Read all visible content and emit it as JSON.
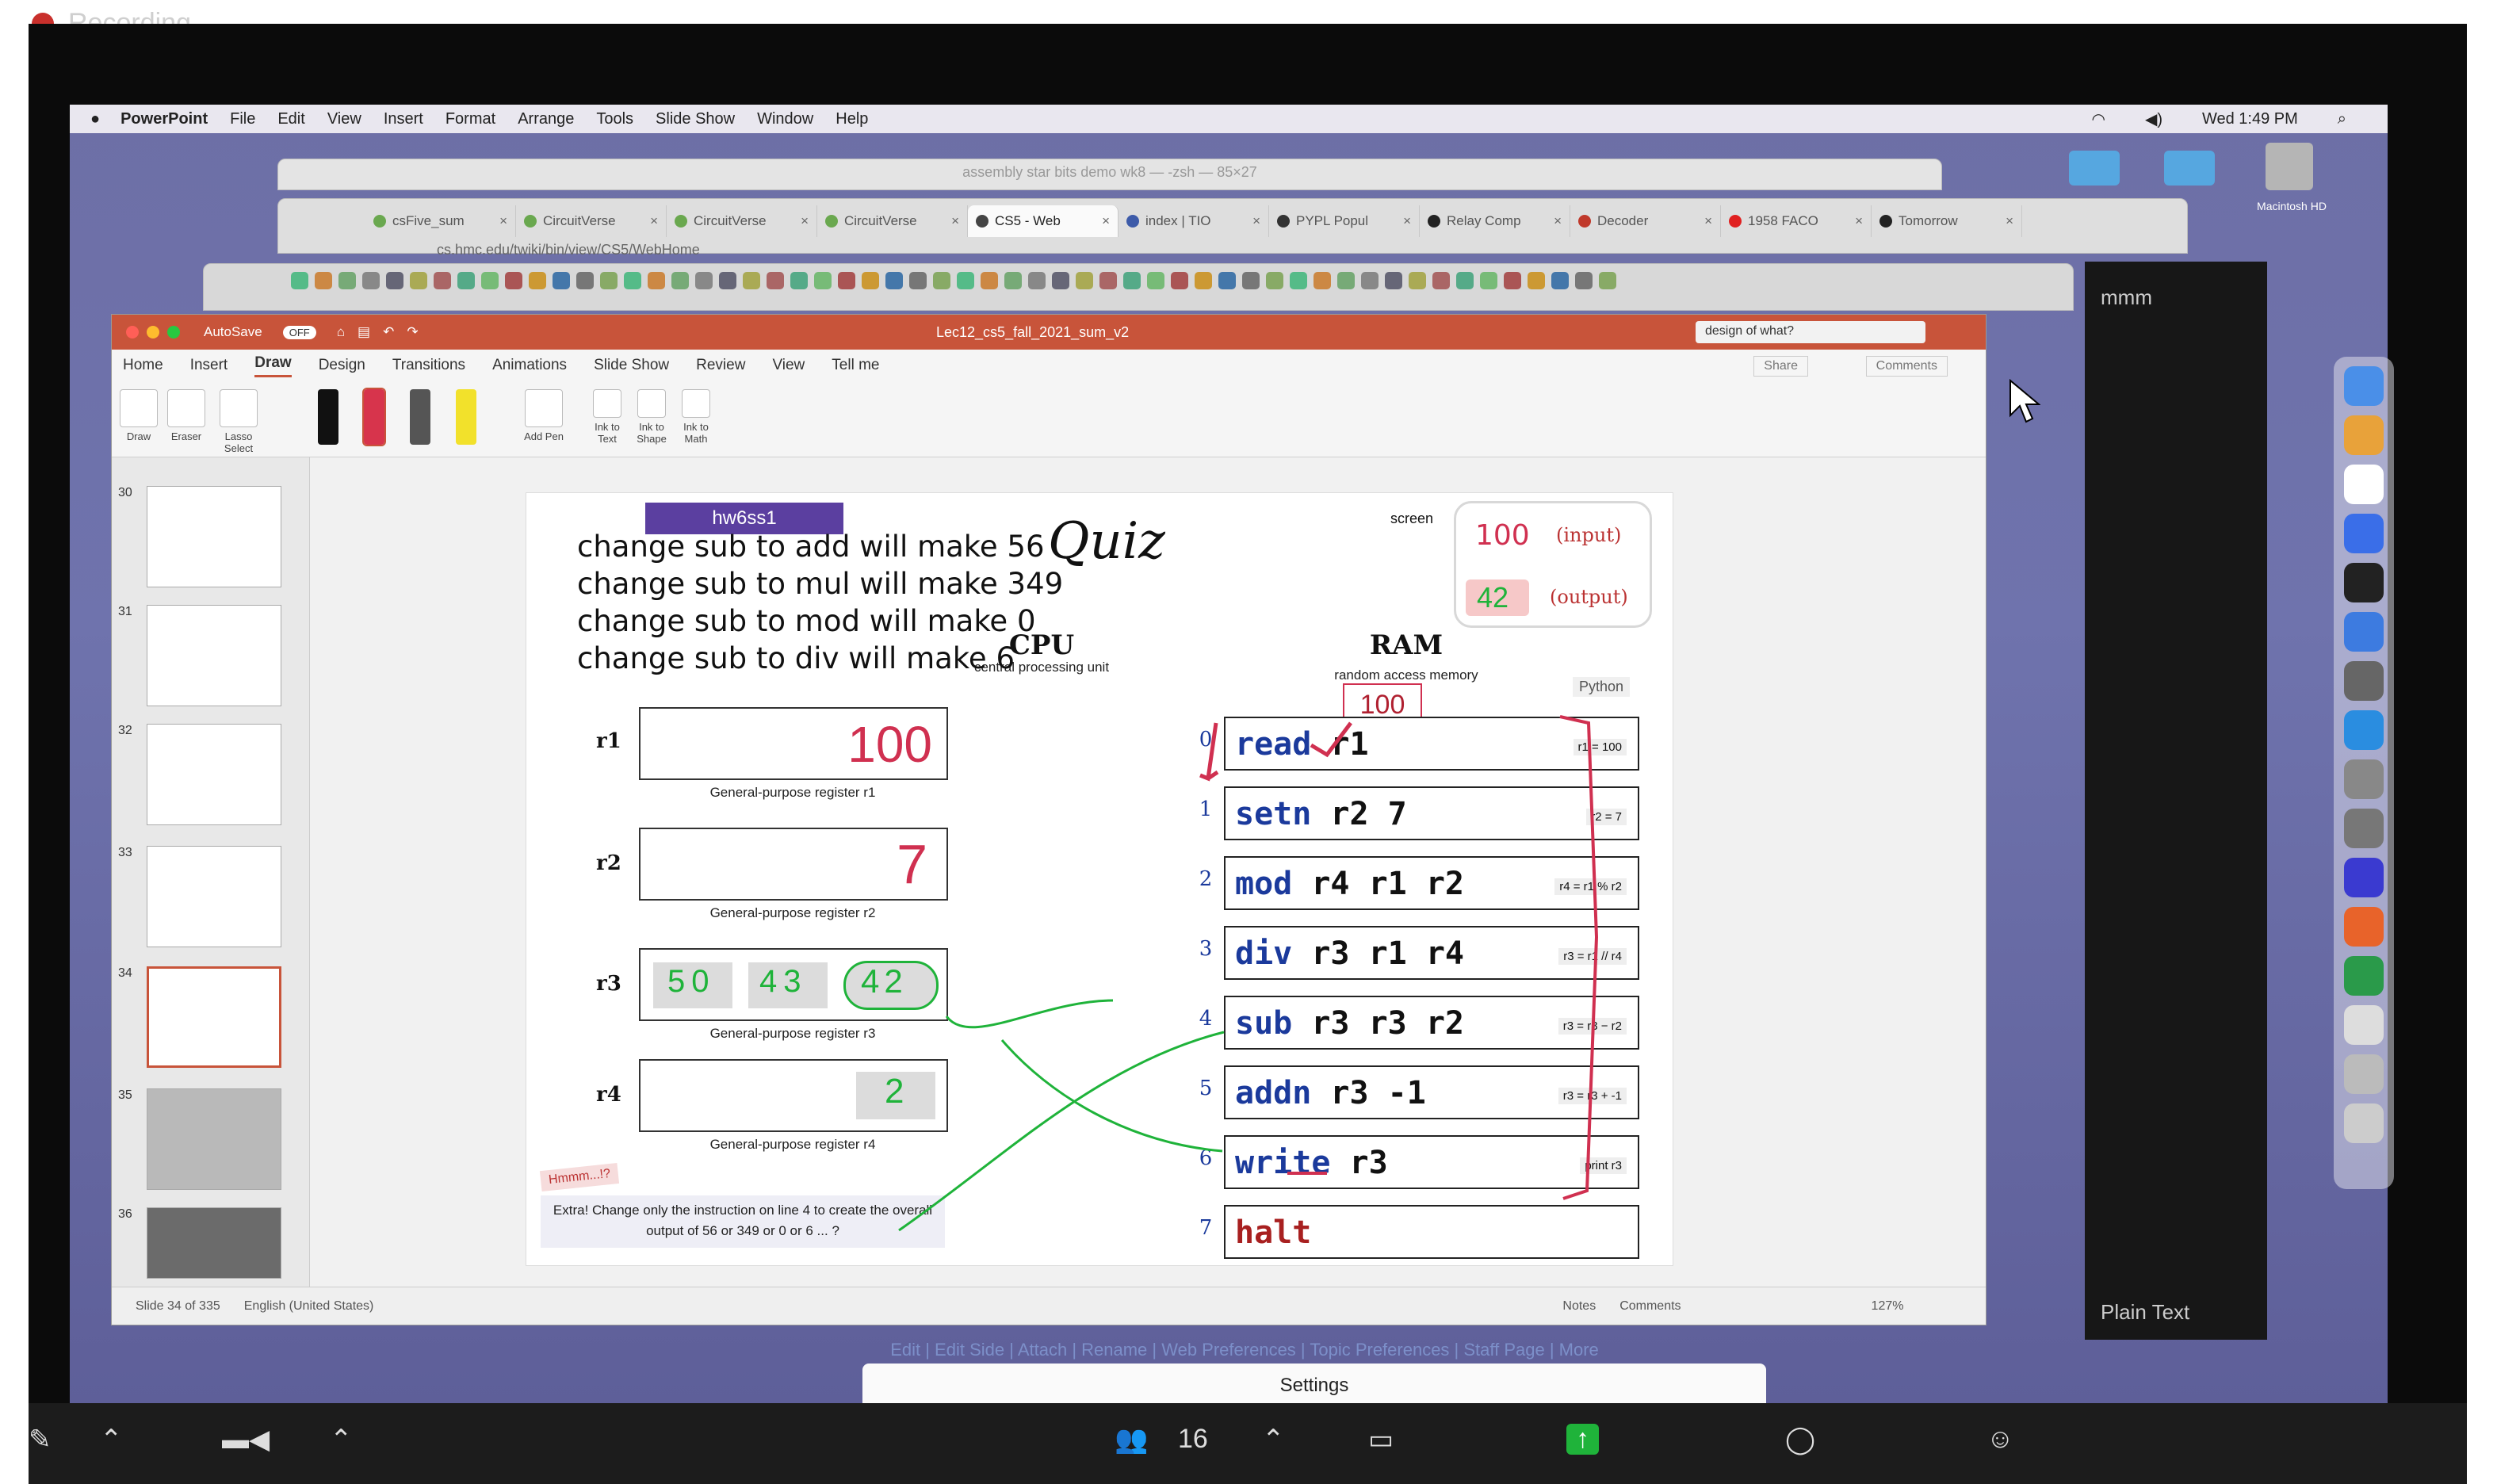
{
  "recording": {
    "label": "Recording"
  },
  "macbar": {
    "menus": [
      "PowerPoint",
      "File",
      "Edit",
      "View",
      "Insert",
      "Format",
      "Arrange",
      "Tools",
      "Slide Show",
      "Window",
      "Help"
    ],
    "clock": "Wed 1:49 PM"
  },
  "terminal": {
    "title": "assembly star bits demo wk8 — -zsh — 85×27"
  },
  "browser_tabs": [
    {
      "label": "csFive_sum",
      "color": "#6aa84f"
    },
    {
      "label": "CircuitVerse",
      "color": "#6aa84f"
    },
    {
      "label": "CircuitVerse",
      "color": "#6aa84f"
    },
    {
      "label": "CircuitVerse",
      "color": "#6aa84f"
    },
    {
      "label": "CS5 - Web",
      "color": "#444444"
    },
    {
      "label": "index | TIO",
      "color": "#3d5ba9"
    },
    {
      "label": "PYPL Popul",
      "color": "#333333"
    },
    {
      "label": "Relay Comp",
      "color": "#222222"
    },
    {
      "label": "Decoder",
      "color": "#c0392b"
    },
    {
      "label": "1958 FACO",
      "color": "#e02020"
    },
    {
      "label": "Tomorrow",
      "color": "#222222"
    }
  ],
  "url": "cs.hmc.edu/twiki/bin/view/CS5/WebHome",
  "ppt": {
    "autosave": "AutoSave",
    "autosave_state": "OFF",
    "filename": "Lec12_cs5_fall_2021_sum_v2",
    "search": "design of what?",
    "ribbon_tabs": [
      "Home",
      "Insert",
      "Draw",
      "Design",
      "Transitions",
      "Animations",
      "Slide Show",
      "Review",
      "View",
      "Tell me"
    ],
    "active_tab": "Draw",
    "share": "Share",
    "comments": "Comments",
    "tools": {
      "draw": "Draw",
      "eraser": "Eraser",
      "lasso": "Lasso Select",
      "add_pen": "Add Pen",
      "ink_text": "Ink to Text",
      "ink_shape": "Ink to Shape",
      "ink_math": "Ink to Math"
    },
    "thumb_numbers": [
      "30",
      "31",
      "32",
      "33",
      "34",
      "35",
      "36"
    ],
    "status": {
      "slide": "Slide 34 of 335",
      "lang": "English (United States)",
      "notes": "Notes",
      "comments": "Comments",
      "zoom": "127%"
    }
  },
  "slide": {
    "tag": "hw6ss1",
    "title": "Quiz",
    "notes": [
      "change sub to add will make 56",
      "change sub to mul will make 349",
      "change sub to mod will make 0",
      "change sub to div will make 6"
    ],
    "cpu": "CPU",
    "cpu_sub": "central processing unit",
    "ram": "RAM",
    "ram_sub": "random access memory",
    "screen": "screen",
    "screen_input_val": "100",
    "screen_input": "(input)",
    "screen_output_val": "42",
    "screen_output": "(output)",
    "python": "Python",
    "ram_badge": "100",
    "registers": [
      {
        "name": "r1",
        "caption": "General-purpose register r1",
        "ink": "100"
      },
      {
        "name": "r2",
        "caption": "General-purpose register r2",
        "ink": "7"
      },
      {
        "name": "r3",
        "caption": "General-purpose register r3",
        "ink": "42"
      },
      {
        "name": "r4",
        "caption": "General-purpose register r4",
        "ink": "2"
      }
    ],
    "r3_history": [
      "50",
      "43"
    ],
    "program": [
      {
        "line": "0",
        "op": "read",
        "args": "r1",
        "comment": "r1 = 100"
      },
      {
        "line": "1",
        "op": "setn",
        "args": "r2 7",
        "comment": "r2 = 7"
      },
      {
        "line": "2",
        "op": "mod",
        "args": "r4 r1 r2",
        "comment": "r4 = r1 % r2"
      },
      {
        "line": "3",
        "op": "div",
        "args": "r3 r1 r4",
        "comment": "r3 = r1 // r4"
      },
      {
        "line": "4",
        "op": "sub",
        "args": "r3 r3 r2",
        "comment": "r3 = r3 − r2"
      },
      {
        "line": "5",
        "op": "addn",
        "args": "r3 -1",
        "comment": "r3 = r3 + -1"
      },
      {
        "line": "6",
        "op": "write",
        "args": "r3",
        "comment": "print r3"
      },
      {
        "line": "7",
        "op": "halt",
        "args": "",
        "comment": ""
      }
    ],
    "hmm": "Hmmm...!?",
    "extra": "Extra! Change only the instruction on line 4 to create the overall output of 56 or 349 or 0 or 6 ... ?"
  },
  "twiki_links": "Edit | Edit Side | Attach | Rename | Web Preferences | Topic Preferences | Staff Page | More",
  "settings": "Settings",
  "participants": "16",
  "plain_text": "Plain Text",
  "desktop_icon": "Macintosh HD"
}
